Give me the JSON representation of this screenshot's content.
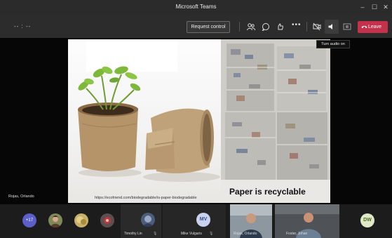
{
  "window": {
    "title": "Microsoft Teams",
    "minimize": "–",
    "maximize": "☐",
    "close": "✕"
  },
  "toolbar": {
    "timer": "-- : --",
    "request_control": "Request control",
    "more": "•••",
    "leave_label": "Leave",
    "tooltip": "Turn audio on"
  },
  "slide": {
    "caption": "Paper is recyclable",
    "url": "https://ecofriend.com/biodegradable/is-paper-biodegradable",
    "presenter": "Rojas, Orlando"
  },
  "participants": {
    "more_count": "+17",
    "tiles": [
      {
        "name": "Timothy Lin"
      },
      {
        "name": "Mike Vulgaris",
        "initials": "MV"
      },
      {
        "name": "Rojas, Orlando"
      },
      {
        "name": "Foster, Johan"
      }
    ],
    "last_initials": "DW"
  },
  "colors": {
    "leave": "#c4314b",
    "accent": "#5b5fc7"
  }
}
